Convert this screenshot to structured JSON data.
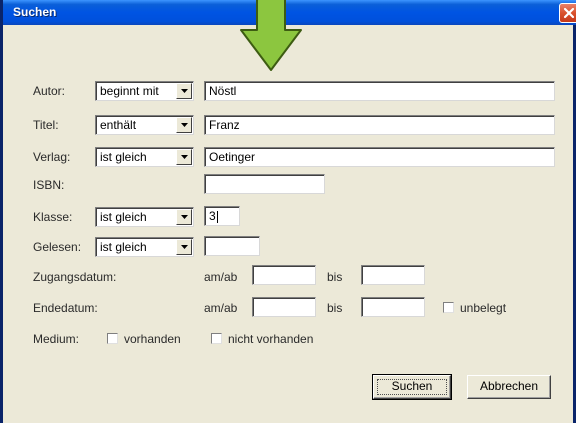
{
  "window": {
    "title": "Suchen"
  },
  "icons": {
    "close": "close-icon",
    "arrow": "down-arrow-icon",
    "dropdown": "chevron-down-icon"
  },
  "colors": {
    "titlebar": "#0054e3",
    "dialog_bg": "#ece9d8",
    "arrow": "#8cc63f",
    "close": "#d9512c"
  },
  "form": {
    "autor": {
      "label": "Autor:",
      "operator": "beginnt mit",
      "value": "Nöstl"
    },
    "titel": {
      "label": "Titel:",
      "operator": "enthält",
      "value": "Franz"
    },
    "verlag": {
      "label": "Verlag:",
      "operator": "ist gleich",
      "value": "Oetinger"
    },
    "isbn": {
      "label": "ISBN:",
      "value": ""
    },
    "klasse": {
      "label": "Klasse:",
      "operator": "ist gleich",
      "value": "3"
    },
    "gelesen": {
      "label": "Gelesen:",
      "operator": "ist gleich",
      "value": ""
    },
    "zugangsdatum": {
      "label": "Zugangsdatum:",
      "from_label": "am/ab",
      "from_value": "",
      "to_label": "bis",
      "to_value": ""
    },
    "endedatum": {
      "label": "Endedatum:",
      "from_label": "am/ab",
      "from_value": "",
      "to_label": "bis",
      "to_value": "",
      "unbelegt_label": "unbelegt",
      "unbelegt_checked": false
    },
    "medium": {
      "label": "Medium:",
      "vorhanden_label": "vorhanden",
      "vorhanden_checked": false,
      "nicht_vorhanden_label": "nicht vorhanden",
      "nicht_vorhanden_checked": false
    }
  },
  "buttons": {
    "search": "Suchen",
    "cancel": "Abbrechen"
  }
}
